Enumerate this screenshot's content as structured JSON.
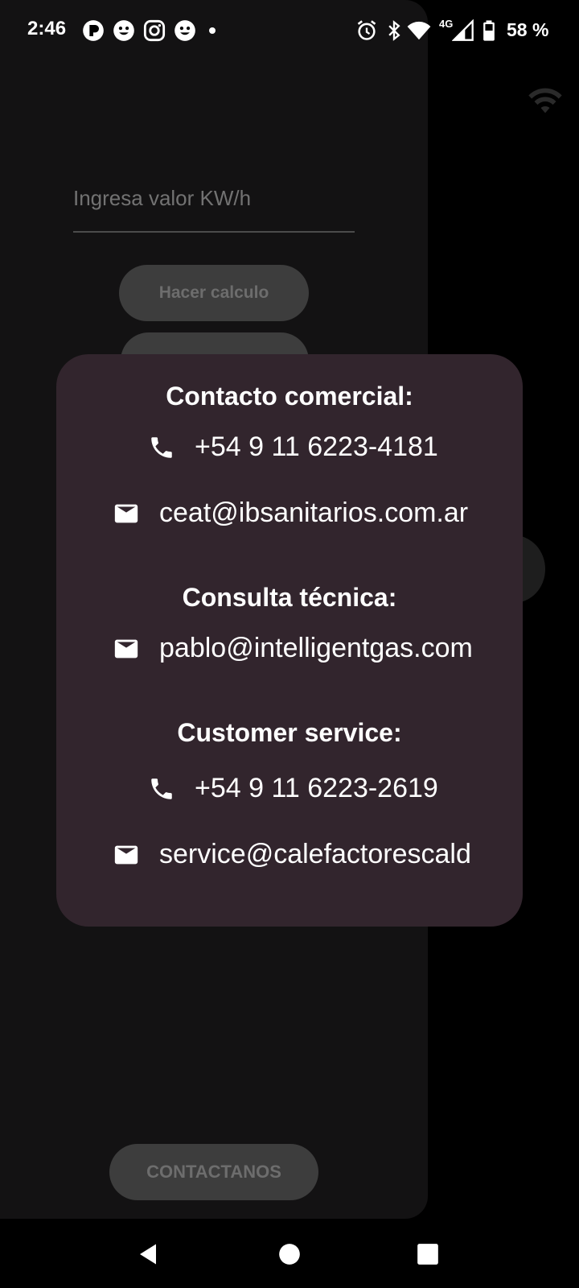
{
  "status_bar": {
    "time": "2:46",
    "network": "4G",
    "battery": "58 %"
  },
  "form": {
    "kwh_placeholder": "Ingresa valor KW/h",
    "calc_button": "Hacer calculo",
    "contact_button": "CONTACTANOS"
  },
  "dialog": {
    "commercial": {
      "title": "Contacto comercial:",
      "phone": "+54 9 11 6223-4181",
      "email": "ceat@ibsanitarios.com.ar"
    },
    "technical": {
      "title": "Consulta técnica:",
      "email": "pablo@intelligentgas.com"
    },
    "customer": {
      "title": "Customer service:",
      "phone": "+54 9 11 6223-2619",
      "email": "service@calefactorescald"
    }
  },
  "colors": {
    "dialog_bg": "#32252d",
    "drawer_bg": "#131213",
    "button_bg": "#3d3d3d",
    "text": "#ffffff"
  },
  "icons": {
    "phone": "phone-icon",
    "email": "email-icon",
    "wifi": "wifi-icon"
  }
}
